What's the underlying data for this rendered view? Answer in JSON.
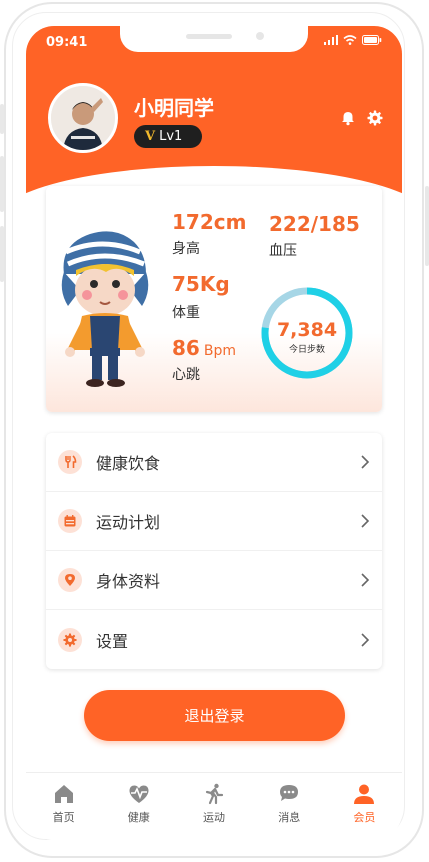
{
  "status_bar": {
    "time": "09:41"
  },
  "profile": {
    "name": "小明同学",
    "level": "Lv1",
    "level_prefix": "V"
  },
  "stats": {
    "height": {
      "value": "172cm",
      "label": "身高"
    },
    "blood_pressure": {
      "value": "222/185",
      "label": "血压"
    },
    "weight": {
      "value": "75Kg",
      "label": "体重"
    },
    "heart_rate": {
      "value": "86",
      "unit": "Bpm",
      "label": "心跳"
    },
    "steps": {
      "value": "7,384",
      "label": "今日步数"
    }
  },
  "menu": [
    {
      "label": "健康饮食",
      "icon": "fork-knife-icon"
    },
    {
      "label": "运动计划",
      "icon": "calendar-icon"
    },
    {
      "label": "身体资料",
      "icon": "location-pin-icon"
    },
    {
      "label": "设置",
      "icon": "gear-icon"
    }
  ],
  "logout_label": "退出登录",
  "tabs": [
    {
      "label": "首页",
      "icon": "home-icon",
      "active": false
    },
    {
      "label": "健康",
      "icon": "heart-pulse-icon",
      "active": false
    },
    {
      "label": "运动",
      "icon": "running-icon",
      "active": false
    },
    {
      "label": "消息",
      "icon": "chat-icon",
      "active": false
    },
    {
      "label": "会员",
      "icon": "user-icon",
      "active": true
    }
  ],
  "colors": {
    "accent": "#ff6326",
    "ring_primary": "#1fd0e6",
    "ring_secondary": "#a6d6e6",
    "badge": "#1f1f1f"
  }
}
